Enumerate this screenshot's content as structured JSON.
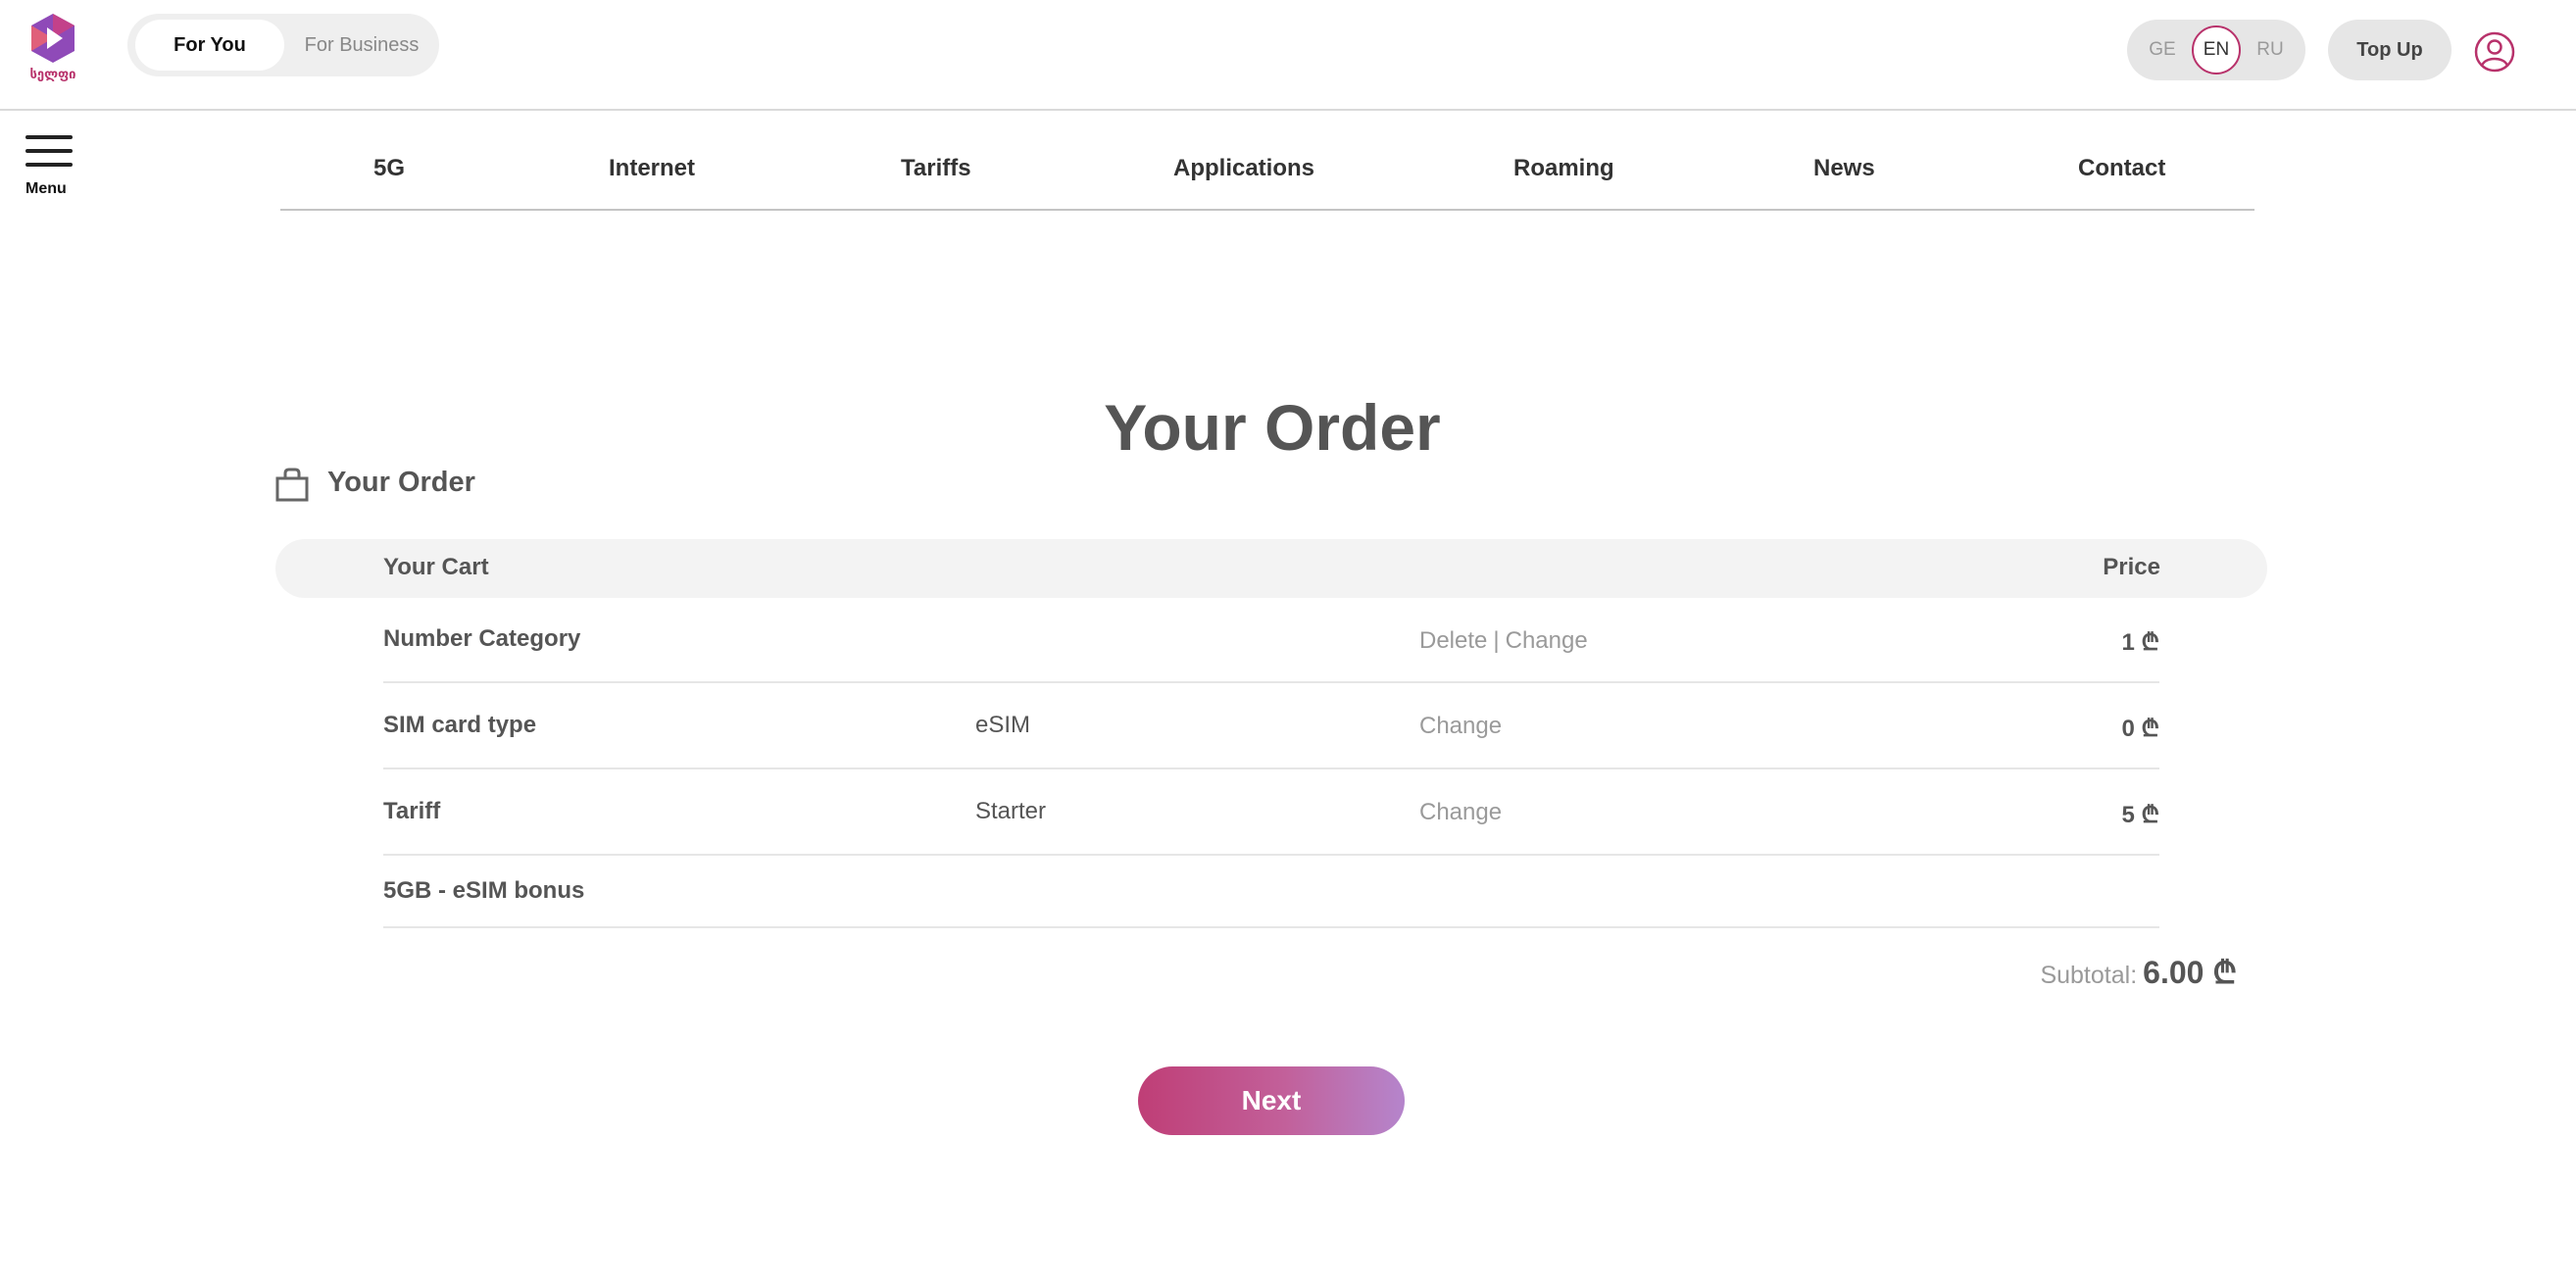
{
  "header": {
    "logo_text": "სელფი",
    "segments": {
      "active": "For You",
      "inactive": "For Business"
    },
    "languages": [
      "GE",
      "EN",
      "RU"
    ],
    "active_language": "EN",
    "top_up_label": "Top Up"
  },
  "nav": {
    "menu_label": "Menu",
    "items": [
      "5G",
      "Internet",
      "Tariffs",
      "Applications",
      "Roaming",
      "News",
      "Contact"
    ]
  },
  "page": {
    "title": "Your Order",
    "section_label": "Your Order"
  },
  "cart": {
    "header": {
      "col_item": "Your Cart",
      "col_price": "Price"
    },
    "rows": [
      {
        "label": "Number Category",
        "value": "",
        "delete": "Delete",
        "separator": "|",
        "change": "Change",
        "price": "1 ₾"
      },
      {
        "label": "SIM card type",
        "value": "eSIM",
        "change": "Change",
        "price": "0 ₾"
      },
      {
        "label": "Tariff",
        "value": "Starter",
        "change": "Change",
        "price": "5 ₾"
      },
      {
        "label": "5GB - eSIM bonus"
      }
    ],
    "subtotal_label": "Subtotal:",
    "subtotal_value": "6.00 ₾"
  },
  "actions": {
    "next_label": "Next"
  },
  "colors": {
    "brand": "#b8326b",
    "gradient_end": "#b585cc"
  },
  "icons": {
    "user": "user-circle-icon",
    "bag": "shopping-bag-icon",
    "menu": "hamburger-menu-icon"
  }
}
